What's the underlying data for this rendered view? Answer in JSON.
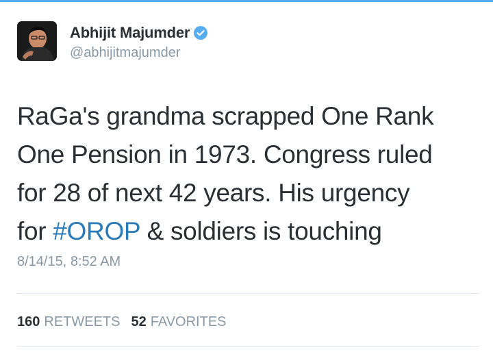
{
  "tweet": {
    "author_name": "Abhijit Majumder",
    "handle": "@abhijitmajumder",
    "verified_icon": "verified-badge-icon",
    "text_lines": [
      "RaGa's grandma scrapped One Rank",
      "One Pension in 1973. Congress ruled",
      "for 28 of next 42 years. His urgency"
    ],
    "last_line": {
      "prefix": "for ",
      "hashtag": "#OROP",
      "suffix": " & soldiers is touching"
    },
    "timestamp": "8/14/15, 8:52 AM",
    "stats": {
      "retweets_count": "160",
      "retweets_label": "RETWEETS",
      "favorites_count": "52",
      "favorites_label": "FAVORITES"
    }
  },
  "colors": {
    "text": "#292f33",
    "secondary": "#8899a6",
    "link": "#2b7bb9",
    "verified": "#55acee",
    "divider": "#e1e8ed"
  }
}
